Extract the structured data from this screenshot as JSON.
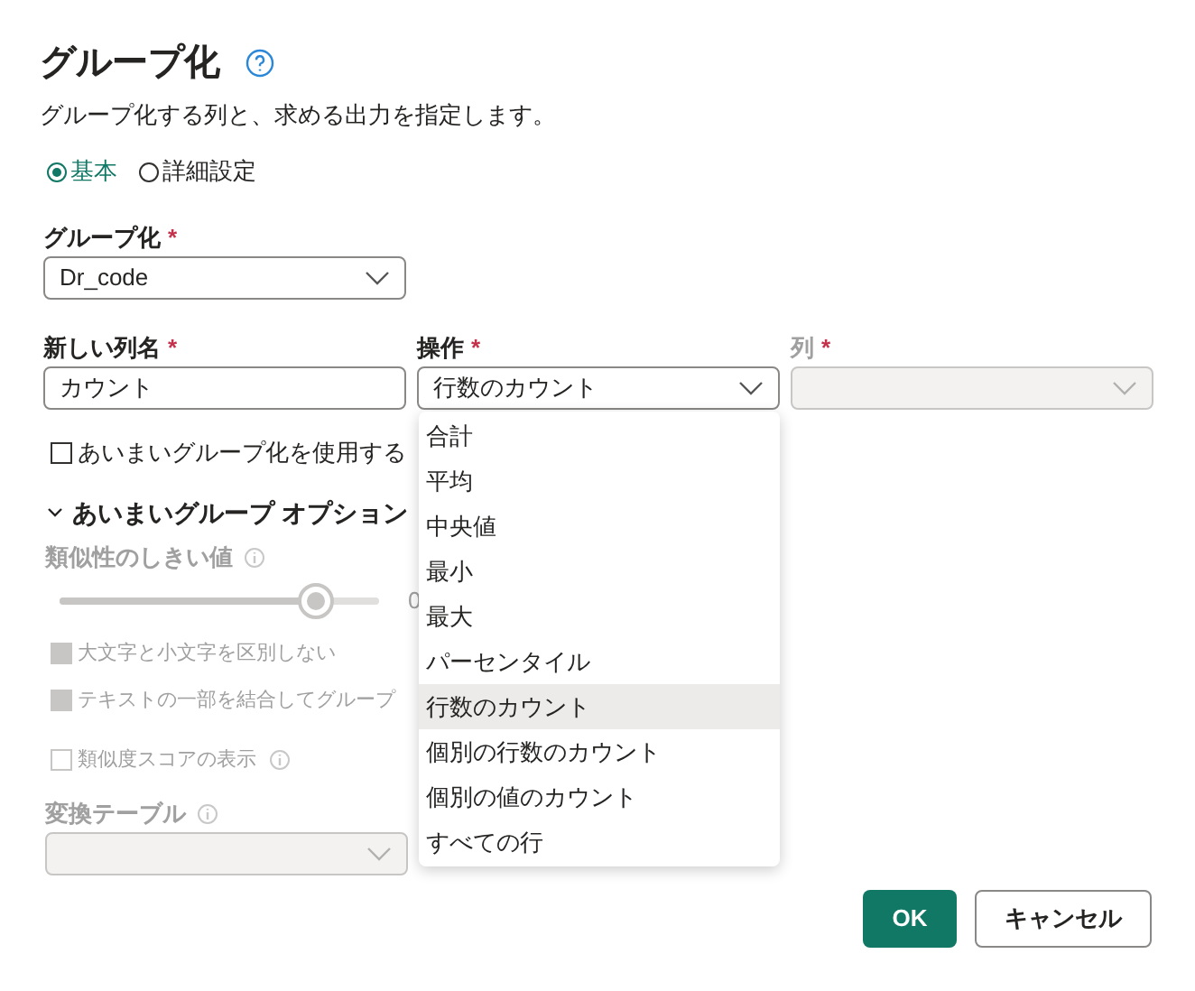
{
  "title": "グループ化",
  "description": "グループ化する列と、求める出力を指定します。",
  "modes": [
    {
      "label": "基本",
      "selected": true
    },
    {
      "label": "詳細設定",
      "selected": false
    }
  ],
  "group_by": {
    "label": "グループ化",
    "required": "*",
    "value": "Dr_code"
  },
  "new_column": {
    "label": "新しい列名",
    "required": "*",
    "value": "カウント"
  },
  "operation": {
    "label": "操作",
    "required": "*",
    "value": "行数のカウント",
    "expanded": true,
    "options": [
      {
        "label": "合計",
        "selected": false
      },
      {
        "label": "平均",
        "selected": false
      },
      {
        "label": "中央値",
        "selected": false
      },
      {
        "label": "最小",
        "selected": false
      },
      {
        "label": "最大",
        "selected": false
      },
      {
        "label": "パーセンタイル",
        "selected": false
      },
      {
        "label": "行数のカウント",
        "selected": true
      },
      {
        "label": "個別の行数のカウント",
        "selected": false
      },
      {
        "label": "個別の値のカウント",
        "selected": false
      },
      {
        "label": "すべての行",
        "selected": false
      }
    ]
  },
  "column": {
    "label": "列",
    "required": "*",
    "disabled": true
  },
  "use_fuzzy": {
    "label": "あいまいグループ化を使用する",
    "checked": false
  },
  "fuzzy_options": {
    "title": "あいまいグループ オプション",
    "expanded": true,
    "threshold": {
      "label": "類似性のしきい値",
      "level": 0.8,
      "reading": "0"
    },
    "checks": [
      {
        "label": "大文字と小文字を区別しない",
        "checked": true,
        "info": false
      },
      {
        "label": "テキストの一部を結合してグループ",
        "checked": true,
        "info": false
      },
      {
        "label": "類似度スコアの表示",
        "checked": false,
        "info": true
      }
    ],
    "transform_table": {
      "label": "変換テーブル"
    }
  },
  "buttons": [
    {
      "label": "OK",
      "kind": "primary"
    },
    {
      "label": "キャンセル",
      "kind": "secondary"
    }
  ]
}
